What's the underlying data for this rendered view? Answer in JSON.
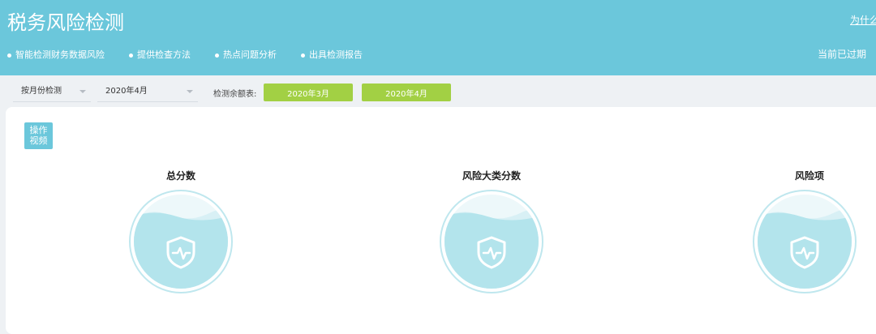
{
  "header": {
    "title": "税务风险检测",
    "why_link": "为什么",
    "features": [
      "智能检测财务数据风险",
      "提供检查方法",
      "热点问题分析",
      "出具检测报告"
    ],
    "status": "当前已过期"
  },
  "filters": {
    "mode": "按月份检测",
    "month": "2020年4月",
    "balance_label": "检测余额表:",
    "months": [
      "2020年3月",
      "2020年4月"
    ]
  },
  "panel": {
    "video_tag": [
      "操作",
      "视频"
    ],
    "metrics": [
      "总分数",
      "风险大类分数",
      "风险项"
    ]
  },
  "colors": {
    "header_bg": "#6bc7db",
    "button_green": "#a2d044",
    "gauge_fill": "#b3e4ec",
    "gauge_ring": "#bfe7ee"
  }
}
